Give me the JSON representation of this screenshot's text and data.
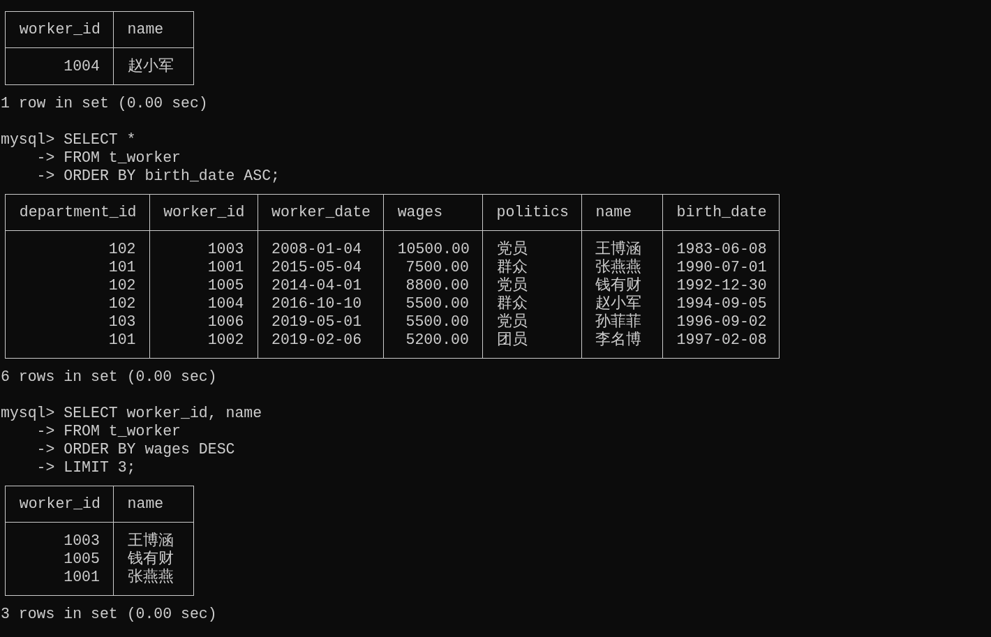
{
  "terminal": {
    "blocks": [
      {
        "kind": "table",
        "columns": [
          {
            "label": "worker_id"
          },
          {
            "label": "name"
          }
        ],
        "rows": [
          [
            "1004",
            "赵小军"
          ]
        ]
      },
      {
        "kind": "summary",
        "text": "1 row in set (0.00 sec)"
      },
      {
        "kind": "query",
        "lines": [
          {
            "prompt": "mysql>",
            "text": "SELECT *"
          },
          {
            "prompt": "->",
            "text": "FROM t_worker"
          },
          {
            "prompt": "->",
            "text": "ORDER BY birth_date ASC;"
          }
        ]
      },
      {
        "kind": "table",
        "columns": [
          {
            "label": "department_id"
          },
          {
            "label": "worker_id"
          },
          {
            "label": "worker_date"
          },
          {
            "label": "wages"
          },
          {
            "label": "politics"
          },
          {
            "label": "name"
          },
          {
            "label": "birth_date"
          }
        ],
        "rows": [
          [
            "102",
            "1003",
            "2008-01-04",
            "10500.00",
            "党员",
            "王博涵",
            "1983-06-08"
          ],
          [
            "101",
            "1001",
            "2015-05-04",
            "7500.00",
            "群众",
            "张燕燕",
            "1990-07-01"
          ],
          [
            "102",
            "1005",
            "2014-04-01",
            "8800.00",
            "党员",
            "钱有财",
            "1992-12-30"
          ],
          [
            "102",
            "1004",
            "2016-10-10",
            "5500.00",
            "群众",
            "赵小军",
            "1994-09-05"
          ],
          [
            "103",
            "1006",
            "2019-05-01",
            "5500.00",
            "党员",
            "孙菲菲",
            "1996-09-02"
          ],
          [
            "101",
            "1002",
            "2019-02-06",
            "5200.00",
            "团员",
            "李名博",
            "1997-02-08"
          ]
        ]
      },
      {
        "kind": "summary",
        "text": "6 rows in set (0.00 sec)"
      },
      {
        "kind": "query",
        "lines": [
          {
            "prompt": "mysql>",
            "text": "SELECT worker_id, name"
          },
          {
            "prompt": "->",
            "text": "FROM t_worker"
          },
          {
            "prompt": "->",
            "text": "ORDER BY wages DESC"
          },
          {
            "prompt": "->",
            "text": "LIMIT 3;"
          }
        ]
      },
      {
        "kind": "table",
        "columns": [
          {
            "label": "worker_id"
          },
          {
            "label": "name"
          }
        ],
        "rows": [
          [
            "1003",
            "王博涵"
          ],
          [
            "1005",
            "钱有财"
          ],
          [
            "1001",
            "张燕燕"
          ]
        ]
      },
      {
        "kind": "summary",
        "text": "3 rows in set (0.00 sec)"
      }
    ]
  }
}
